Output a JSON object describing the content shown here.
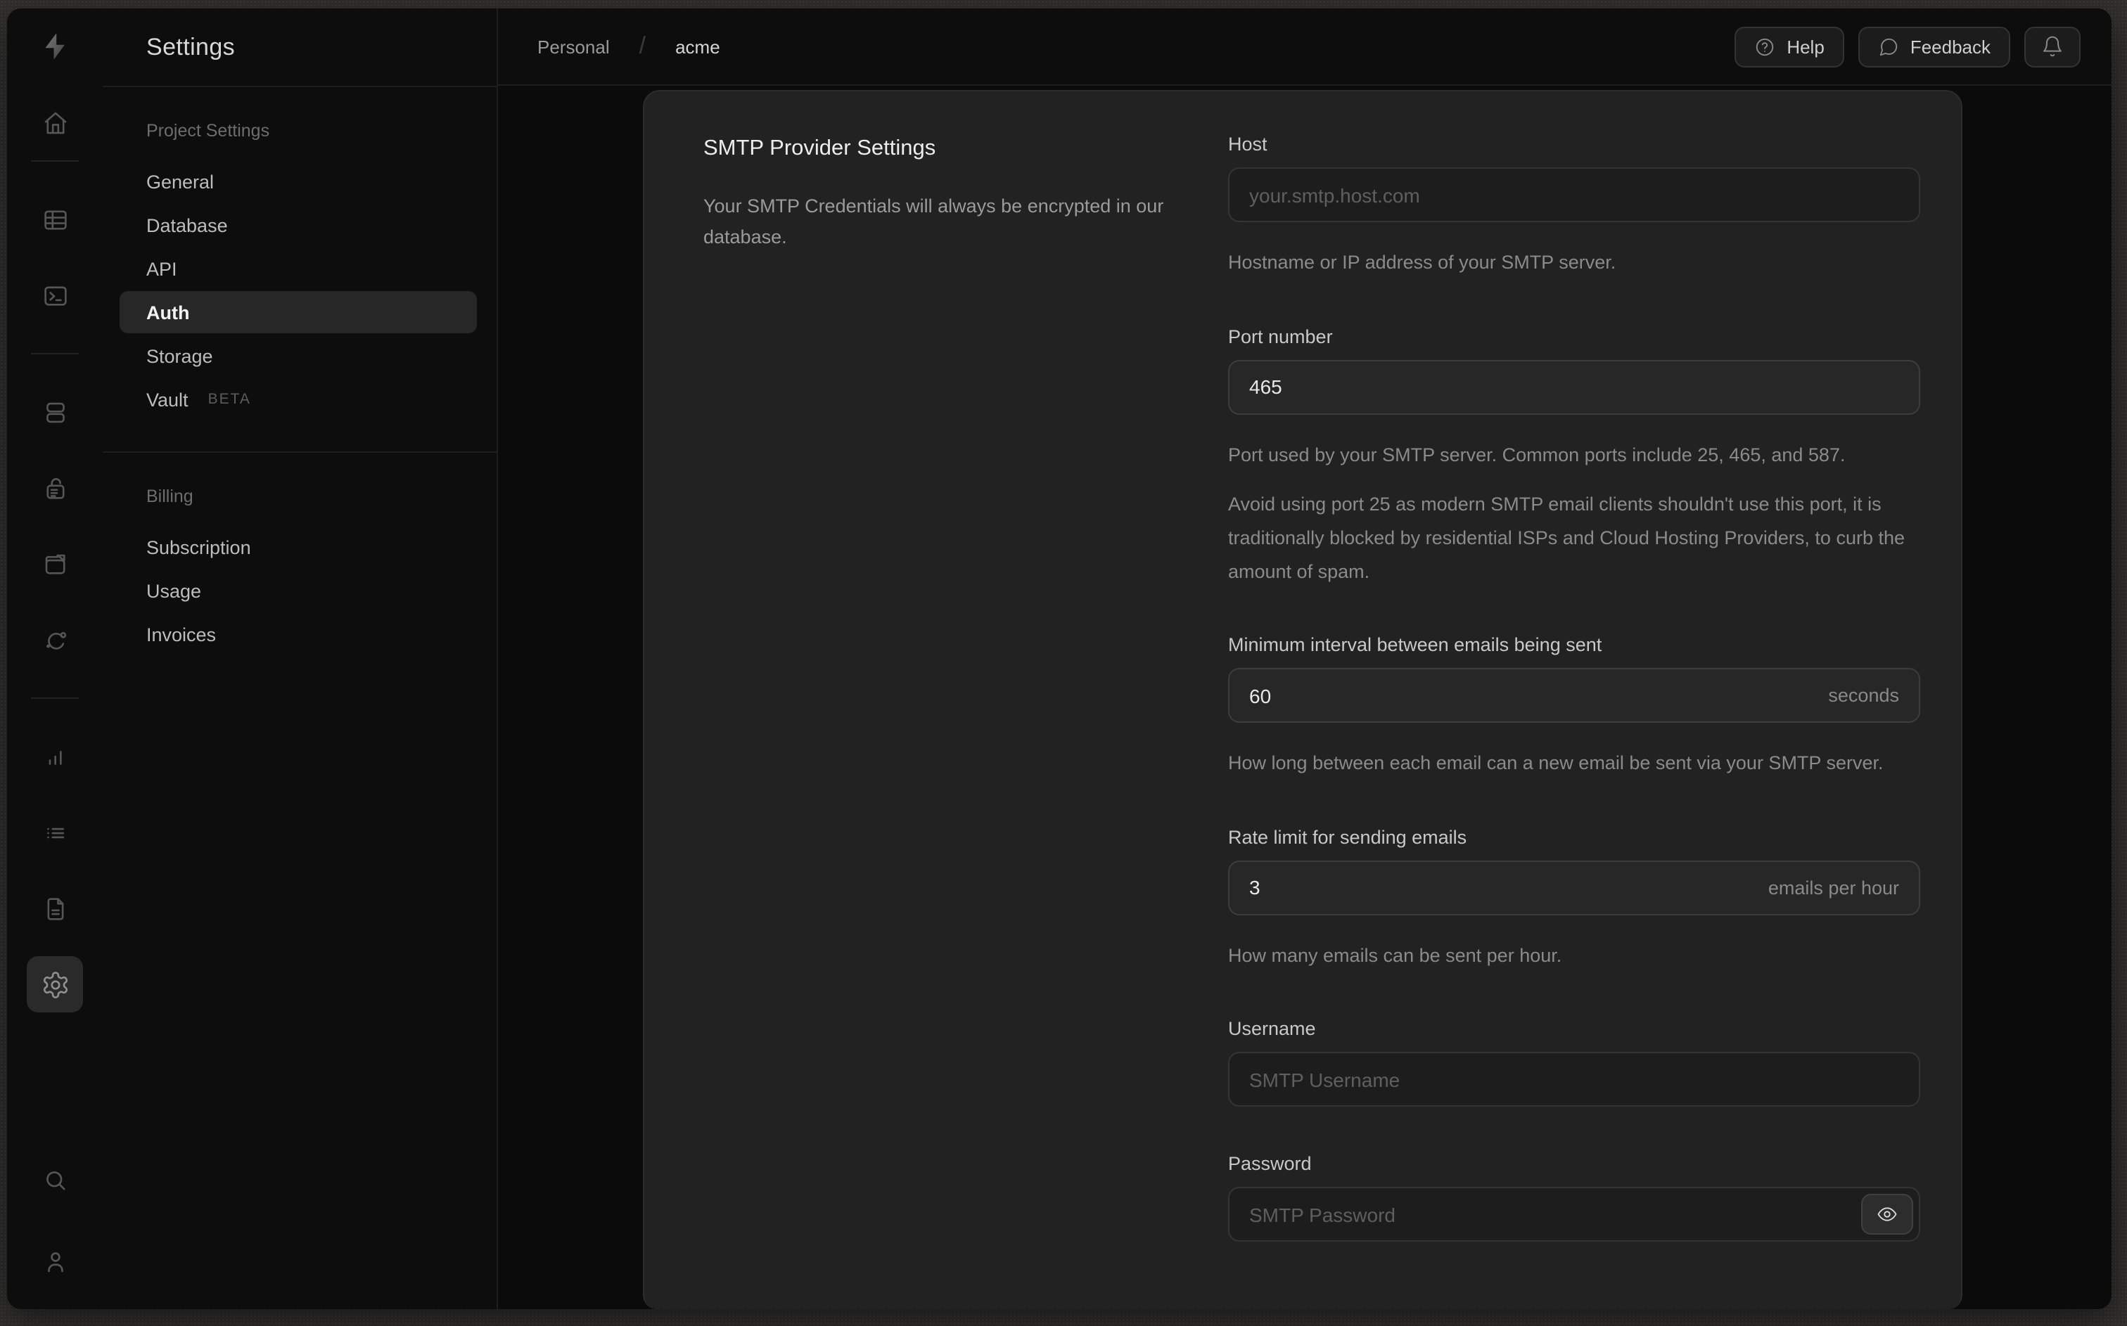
{
  "colors": {
    "window_bg": "#0d0d0d",
    "panel_bg": "#222222",
    "border": "#1e1e1e",
    "active_pill": "#272727",
    "text_primary": "#ededed",
    "text_muted": "#8b8b8b"
  },
  "rail": {
    "icons": [
      "supabase-logo",
      "home",
      "table-editor",
      "sql-editor",
      "database",
      "authentication",
      "storage",
      "edge-functions",
      "reports",
      "logs",
      "api-docs",
      "project-settings",
      "search",
      "account"
    ]
  },
  "nav": {
    "title": "Settings",
    "sections": [
      {
        "heading": "Project Settings",
        "items": [
          {
            "label": "General"
          },
          {
            "label": "Database"
          },
          {
            "label": "API"
          },
          {
            "label": "Auth",
            "active": true
          },
          {
            "label": "Storage"
          },
          {
            "label": "Vault",
            "badge": "BETA"
          }
        ]
      },
      {
        "heading": "Billing",
        "items": [
          {
            "label": "Subscription"
          },
          {
            "label": "Usage"
          },
          {
            "label": "Invoices"
          }
        ]
      }
    ]
  },
  "topbar": {
    "breadcrumb": {
      "org": "Personal",
      "separator": "/",
      "project": "acme"
    },
    "help_label": "Help",
    "feedback_label": "Feedback"
  },
  "panel": {
    "heading": "SMTP Provider Settings",
    "description": "Your SMTP Credentials will always be encrypted in our database.",
    "fields": {
      "host": {
        "label": "Host",
        "placeholder": "your.smtp.host.com",
        "helper": "Hostname or IP address of your SMTP server."
      },
      "port": {
        "label": "Port number",
        "value": "465",
        "helper1": "Port used by your SMTP server. Common ports include 25, 465, and 587.",
        "helper2": "Avoid using port 25 as modern SMTP email clients shouldn't use this port, it is traditionally blocked by residential ISPs and Cloud Hosting Providers, to curb the amount of spam."
      },
      "interval": {
        "label": "Minimum interval between emails being sent",
        "value": "60",
        "suffix": "seconds",
        "helper": "How long between each email can a new email be sent via your SMTP server."
      },
      "rate": {
        "label": "Rate limit for sending emails",
        "value": "3",
        "suffix": "emails per hour",
        "helper": "How many emails can be sent per hour."
      },
      "username": {
        "label": "Username",
        "placeholder": "SMTP Username"
      },
      "password": {
        "label": "Password",
        "placeholder": "SMTP Password"
      }
    }
  }
}
